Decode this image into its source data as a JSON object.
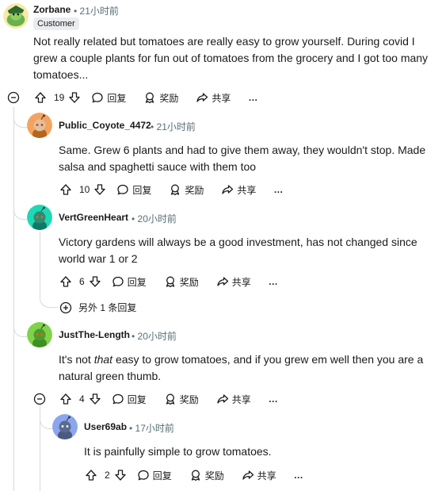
{
  "comments": [
    {
      "author": "Zorbane",
      "time": "• 21小时前",
      "flair": "Customer",
      "lines": [
        "Not really related but tomatoes are really easy to grow yourself. During covid I",
        "grew a couple plants for fun out of tomatoes from the grocery and I got too many",
        "tomatoes..."
      ],
      "votes": "19",
      "reply_label": "回复",
      "award_label": "奖励",
      "share_label": "共享",
      "avatar_color": "#7cc25a"
    },
    {
      "author": "Public_Coyote_4472",
      "time": "• 21小时前",
      "lines": [
        "Same. Grew 6 plants and had to give them away, they wouldn't stop. Made",
        "salsa and spaghetti sauce with them too"
      ],
      "votes": "10",
      "reply_label": "回复",
      "award_label": "奖励",
      "share_label": "共享",
      "avatar_color": "#f4a35f"
    },
    {
      "author": "VertGreenHeart",
      "time": "• 20小时前",
      "lines": [
        "Victory gardens will always be a good investment, has not changed since",
        "world war 1 or 2"
      ],
      "votes": "6",
      "reply_label": "回复",
      "award_label": "奖励",
      "share_label": "共享",
      "avatar_color": "#1ed8b4",
      "more_replies": "另外 1 条回复"
    },
    {
      "author": "JustThe-Length",
      "time": "• 20小时前",
      "line1_pre": "It's not ",
      "line1_em": "that",
      "line1_post": " easy to grow tomatoes, and if you grew em well then you are a",
      "line2": "natural green thumb.",
      "votes": "4",
      "reply_label": "回复",
      "award_label": "奖励",
      "share_label": "共享",
      "avatar_color": "#7fd34a"
    },
    {
      "author": "User69ab",
      "time": "• 17小时前",
      "lines": [
        "It is painfully simple to grow tomatoes."
      ],
      "votes": "2",
      "reply_label": "回复",
      "award_label": "奖励",
      "share_label": "共享",
      "avatar_color": "#8aa6ef"
    }
  ],
  "more_label": "…"
}
